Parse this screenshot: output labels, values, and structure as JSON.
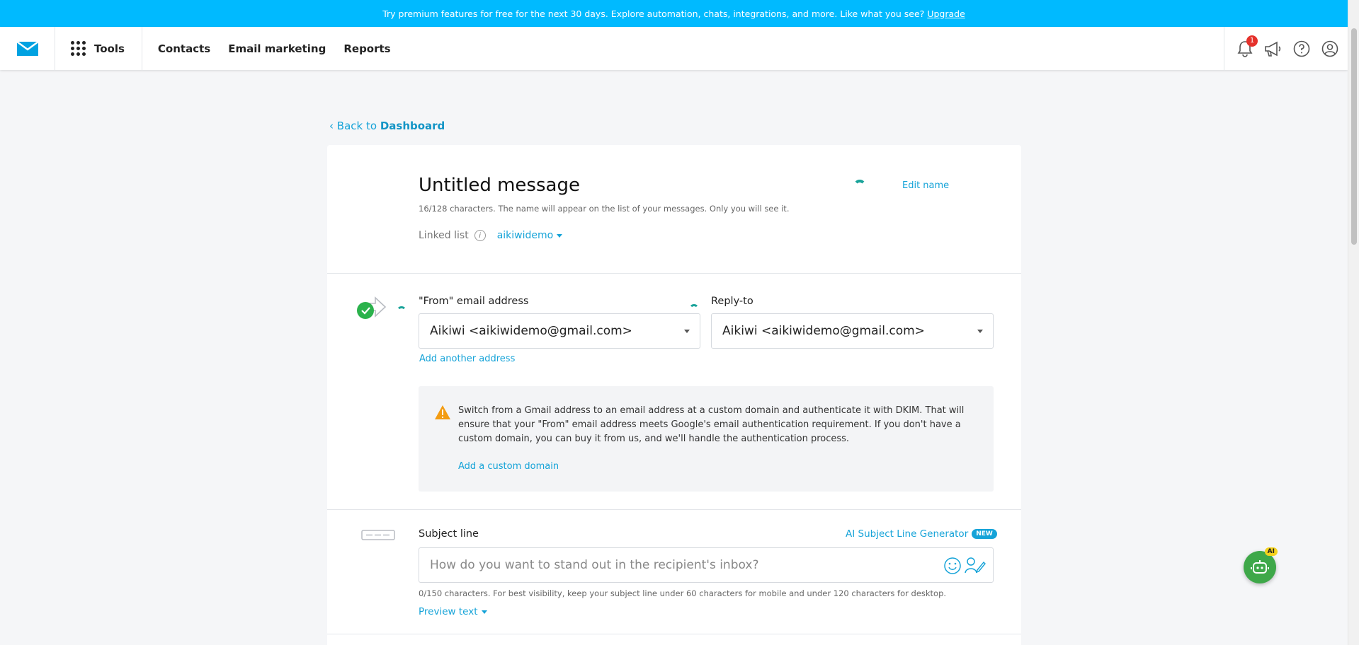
{
  "promo": {
    "text": "Try premium features for free for the next 30 days. Explore automation, chats, integrations, and more. Like what you see?",
    "link": "Upgrade"
  },
  "nav": {
    "tools": "Tools",
    "links": [
      "Contacts",
      "Email marketing",
      "Reports"
    ],
    "notifications_count": "1"
  },
  "back": {
    "prefix": "Back to",
    "target": "Dashboard"
  },
  "message": {
    "title": "Untitled message",
    "edit_name": "Edit name",
    "hint": "16/128 characters. The name will appear on the list of your messages. Only you will see it.",
    "linked_list_label": "Linked list",
    "linked_list_value": "aikiwidemo"
  },
  "from": {
    "label": "\"From\" email address",
    "value": "Aikiwi <aikiwidemo@gmail.com>",
    "add_another": "Add another address"
  },
  "reply_to": {
    "label": "Reply-to",
    "value": "Aikiwi <aikiwidemo@gmail.com>"
  },
  "warning": {
    "text": "Switch from a Gmail address to an email address at a custom domain and authenticate it with DKIM. That will ensure that your \"From\" email address meets Google's email authentication requirement. If you don't have a custom domain, you can buy it from us, and we'll handle the authentication process.",
    "link": "Add a custom domain"
  },
  "subject": {
    "label": "Subject line",
    "ai_generator": "AI Subject Line Generator",
    "new_badge": "NEW",
    "placeholder": "How do you want to stand out in the recipient's inbox?",
    "hint": "0/150 characters. For best visibility, keep your subject line under 60 characters for mobile and under 120 characters for desktop.",
    "preview_text": "Preview text"
  },
  "ai_bot": {
    "tag": "AI"
  },
  "colors": {
    "accent": "#15a3d8",
    "promo": "#00baff",
    "success": "#2bb24c",
    "warning": "#f39c12"
  }
}
